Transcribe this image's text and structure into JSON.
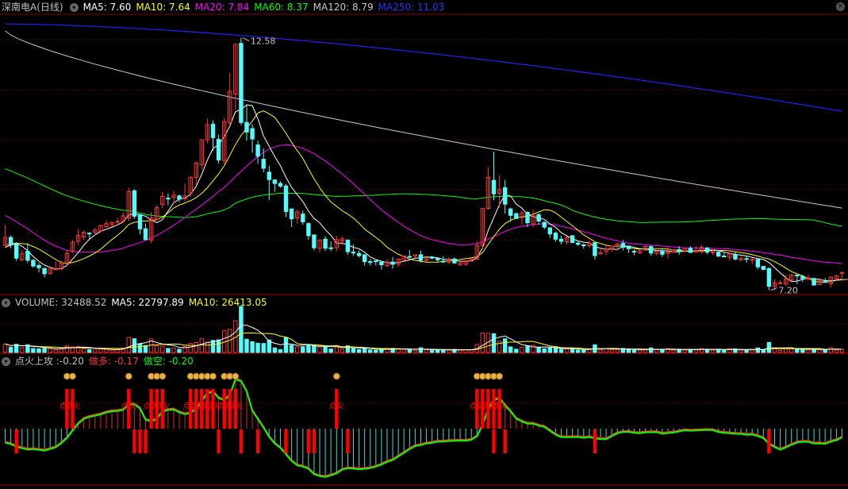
{
  "colors": {
    "up": "#ff3232",
    "down": "#54fcfc",
    "ma5": "#ffffff",
    "ma10": "#ffff00",
    "ma20": "#ff00ff",
    "ma60": "#00ff00",
    "ma120": "#c8c8c8",
    "ma250": "#2020ff",
    "grid": "#8b0000",
    "signal": "#ff0000",
    "spark": "#ffff00"
  },
  "price_panel": {
    "title": "深南电A(日线)",
    "ma5": "MA5: 7.60",
    "ma10": "MA10: 7.64",
    "ma20": "MA20: 7.84",
    "ma60": "MA60: 8.37",
    "ma120": "MA120: 8.79",
    "ma250": "MA250: 11.03",
    "high_label": "12.58",
    "low_label": "7.20"
  },
  "volume_panel": {
    "title": "VOLUME: 32488.52",
    "ma5": "MA5: 22797.89",
    "ma10": "MA10: 26413.05"
  },
  "indicator_panel": {
    "title": "点火上攻 :-0.20",
    "zuoduo": "做多: -0.17",
    "zuokong": "做空: -0.20",
    "fire_label": "点火"
  },
  "chart_data": {
    "type": "candlestick",
    "ylim": [
      6.9,
      13.2
    ],
    "candles": [
      [
        7.93,
        8.11,
        8.4,
        7.87
      ],
      [
        8.11,
        7.94,
        8.16,
        7.86
      ],
      [
        7.95,
        7.63,
        8.0,
        7.57
      ],
      [
        7.59,
        7.73,
        7.82,
        7.56
      ],
      [
        7.79,
        7.58,
        7.98,
        7.52
      ],
      [
        7.58,
        7.45,
        7.62,
        7.41
      ],
      [
        7.46,
        7.41,
        7.52,
        7.3
      ],
      [
        7.39,
        7.27,
        7.42,
        7.19
      ],
      [
        7.28,
        7.39,
        7.44,
        7.24
      ],
      [
        7.37,
        7.38,
        7.56,
        7.36
      ],
      [
        7.38,
        7.52,
        7.58,
        7.35
      ],
      [
        7.5,
        7.74,
        7.82,
        7.46
      ],
      [
        7.79,
        8.0,
        8.05,
        7.75
      ],
      [
        8.02,
        8.16,
        8.3,
        7.93
      ],
      [
        8.12,
        8.23,
        8.27,
        8.05
      ],
      [
        8.21,
        8.2,
        8.23,
        8.05
      ],
      [
        8.23,
        8.28,
        8.33,
        8.16
      ],
      [
        8.26,
        8.38,
        8.41,
        8.23
      ],
      [
        8.36,
        8.43,
        8.5,
        8.33
      ],
      [
        8.41,
        8.45,
        8.49,
        8.36
      ],
      [
        8.47,
        8.48,
        8.57,
        8.4
      ],
      [
        8.49,
        8.61,
        8.69,
        8.44
      ],
      [
        8.56,
        9.17,
        9.26,
        8.49
      ],
      [
        9.19,
        8.6,
        9.23,
        8.54
      ],
      [
        8.64,
        8.31,
        8.65,
        8.18
      ],
      [
        8.31,
        8.06,
        8.43,
        8.05
      ],
      [
        8.05,
        8.56,
        8.7,
        7.98
      ],
      [
        8.53,
        8.8,
        8.86,
        8.5
      ],
      [
        8.87,
        9.06,
        9.16,
        8.79
      ],
      [
        9.02,
        9.0,
        9.13,
        8.86
      ],
      [
        9.04,
        9.09,
        9.19,
        8.9
      ],
      [
        9.07,
        9.0,
        9.1,
        8.93
      ],
      [
        9.01,
        9.07,
        9.36,
        8.95
      ],
      [
        9.14,
        9.5,
        9.53,
        9.05
      ],
      [
        9.5,
        9.83,
        9.87,
        9.31
      ],
      [
        9.79,
        10.37,
        10.37,
        9.68
      ],
      [
        10.37,
        10.72,
        10.86,
        10.29
      ],
      [
        10.73,
        10.42,
        10.82,
        10.11
      ],
      [
        10.38,
        9.9,
        10.49,
        9.82
      ],
      [
        9.89,
        10.79,
        10.88,
        9.81
      ],
      [
        10.77,
        11.49,
        11.91,
        10.7
      ],
      [
        11.43,
        12.58,
        12.58,
        11.06
      ],
      [
        12.6,
        10.77,
        12.73,
        10.71
      ],
      [
        10.77,
        10.55,
        11.18,
        10.35
      ],
      [
        10.63,
        10.39,
        10.73,
        10.07
      ],
      [
        10.25,
        9.99,
        10.35,
        9.81
      ],
      [
        9.92,
        9.71,
        10.17,
        9.62
      ],
      [
        9.62,
        9.45,
        9.77,
        8.97
      ],
      [
        9.44,
        9.36,
        9.46,
        9.17
      ],
      [
        9.36,
        9.3,
        9.41,
        9.26
      ],
      [
        9.3,
        8.71,
        9.35,
        8.58
      ],
      [
        8.77,
        8.54,
        8.77,
        8.35
      ],
      [
        8.56,
        8.7,
        8.76,
        8.43
      ],
      [
        8.65,
        8.47,
        8.73,
        8.4
      ],
      [
        8.43,
        8.15,
        8.46,
        8.06
      ],
      [
        8.17,
        7.87,
        8.17,
        7.81
      ],
      [
        7.86,
        8.05,
        8.07,
        7.76
      ],
      [
        8.07,
        7.86,
        8.14,
        7.8
      ],
      [
        7.87,
        7.86,
        8.02,
        7.79
      ],
      [
        7.87,
        8.06,
        8.15,
        7.79
      ],
      [
        8.03,
        8.08,
        8.13,
        7.92
      ],
      [
        8.05,
        7.78,
        8.06,
        7.71
      ],
      [
        7.77,
        7.75,
        7.95,
        7.69
      ],
      [
        7.74,
        7.69,
        7.81,
        7.65
      ],
      [
        7.71,
        7.55,
        7.72,
        7.46
      ],
      [
        7.55,
        7.53,
        7.61,
        7.46
      ],
      [
        7.57,
        7.55,
        7.57,
        7.46
      ],
      [
        7.54,
        7.48,
        7.57,
        7.37
      ],
      [
        7.46,
        7.54,
        7.61,
        7.42
      ],
      [
        7.54,
        7.49,
        7.66,
        7.39
      ],
      [
        7.49,
        7.61,
        7.62,
        7.42
      ],
      [
        7.59,
        7.68,
        7.68,
        7.53
      ],
      [
        7.67,
        7.66,
        7.82,
        7.64
      ],
      [
        7.68,
        7.71,
        7.72,
        7.63
      ],
      [
        7.71,
        7.58,
        7.8,
        7.53
      ],
      [
        7.58,
        7.64,
        7.68,
        7.54
      ],
      [
        7.66,
        7.63,
        7.67,
        7.6
      ],
      [
        7.62,
        7.59,
        7.65,
        7.55
      ],
      [
        7.56,
        7.55,
        7.68,
        7.52
      ],
      [
        7.53,
        7.61,
        7.65,
        7.51
      ],
      [
        7.61,
        7.52,
        7.65,
        7.5
      ],
      [
        7.48,
        7.52,
        7.56,
        7.45
      ],
      [
        7.49,
        7.57,
        7.58,
        7.45
      ],
      [
        7.56,
        7.61,
        7.65,
        7.54
      ],
      [
        7.61,
        7.92,
        8.03,
        7.6
      ],
      [
        7.92,
        8.78,
        8.79,
        7.85
      ],
      [
        8.78,
        9.5,
        9.74,
        8.76
      ],
      [
        9.43,
        9.12,
        10.09,
        8.97
      ],
      [
        9.13,
        9.22,
        9.55,
        8.79
      ],
      [
        9.26,
        8.88,
        9.44,
        8.66
      ],
      [
        8.77,
        8.62,
        8.8,
        8.47
      ],
      [
        8.66,
        8.55,
        8.69,
        8.54
      ],
      [
        8.57,
        8.68,
        8.73,
        8.4
      ],
      [
        8.69,
        8.45,
        8.71,
        8.35
      ],
      [
        8.42,
        8.63,
        8.76,
        8.35
      ],
      [
        8.64,
        8.49,
        8.67,
        8.4
      ],
      [
        8.46,
        8.35,
        8.49,
        8.3
      ],
      [
        8.33,
        8.19,
        8.35,
        8.1
      ],
      [
        8.21,
        8.07,
        8.25,
        8.01
      ],
      [
        8.07,
        8.02,
        8.15,
        7.95
      ],
      [
        8.01,
        8.11,
        8.14,
        7.95
      ],
      [
        8.15,
        7.99,
        8.15,
        7.98
      ],
      [
        7.98,
        7.95,
        8.04,
        7.92
      ],
      [
        7.94,
        7.92,
        7.97,
        7.85
      ],
      [
        7.92,
        7.98,
        8.04,
        7.86
      ],
      [
        7.99,
        7.69,
        8.01,
        7.6
      ],
      [
        7.73,
        7.76,
        7.88,
        7.71
      ],
      [
        7.79,
        7.84,
        7.95,
        7.7
      ],
      [
        7.85,
        7.91,
        7.91,
        7.78
      ],
      [
        7.92,
        7.96,
        7.99,
        7.82
      ],
      [
        7.97,
        7.88,
        8.05,
        7.81
      ],
      [
        7.91,
        7.85,
        7.93,
        7.75
      ],
      [
        7.79,
        7.78,
        7.82,
        7.7
      ],
      [
        7.75,
        7.8,
        7.83,
        7.73
      ],
      [
        7.82,
        7.9,
        7.92,
        7.8
      ],
      [
        7.9,
        7.75,
        7.93,
        7.69
      ],
      [
        7.74,
        7.79,
        7.86,
        7.7
      ],
      [
        7.79,
        7.72,
        7.84,
        7.66
      ],
      [
        7.74,
        7.77,
        7.88,
        7.62
      ],
      [
        7.77,
        7.83,
        7.84,
        7.76
      ],
      [
        7.83,
        7.79,
        7.91,
        7.71
      ],
      [
        7.8,
        7.86,
        7.86,
        7.76
      ],
      [
        7.86,
        7.76,
        7.91,
        7.76
      ],
      [
        7.77,
        7.81,
        7.91,
        7.76
      ],
      [
        7.78,
        7.88,
        7.94,
        7.73
      ],
      [
        7.87,
        7.77,
        7.88,
        7.72
      ],
      [
        7.76,
        7.78,
        7.83,
        7.7
      ],
      [
        7.77,
        7.68,
        7.82,
        7.65
      ],
      [
        7.68,
        7.67,
        7.75,
        7.65
      ],
      [
        7.65,
        7.73,
        7.78,
        7.57
      ],
      [
        7.71,
        7.61,
        7.77,
        7.58
      ],
      [
        7.59,
        7.63,
        7.67,
        7.56
      ],
      [
        7.62,
        7.61,
        7.67,
        7.52
      ],
      [
        7.6,
        7.6,
        7.64,
        7.49
      ],
      [
        7.6,
        7.43,
        7.6,
        7.37
      ],
      [
        7.44,
        7.37,
        7.44,
        7.35
      ],
      [
        7.39,
        6.98,
        7.42,
        6.89
      ],
      [
        6.98,
        7.06,
        7.14,
        6.89
      ],
      [
        7.06,
        7.06,
        7.12,
        7.02
      ],
      [
        7.03,
        7.15,
        7.24,
        6.98
      ],
      [
        7.12,
        7.24,
        7.27,
        7.09
      ],
      [
        7.24,
        7.22,
        7.24,
        7.03
      ],
      [
        7.21,
        7.16,
        7.24,
        7.08
      ],
      [
        7.14,
        7.17,
        7.25,
        7.13
      ],
      [
        7.16,
        7.01,
        7.17,
        6.99
      ],
      [
        7.02,
        7.12,
        7.16,
        7.02
      ],
      [
        7.09,
        7.07,
        7.17,
        7.06
      ],
      [
        7.04,
        7.19,
        7.21,
        6.95
      ],
      [
        7.15,
        7.23,
        7.24,
        7.12
      ],
      [
        7.28,
        7.3,
        7.32,
        7.11
      ]
    ],
    "ma5": [
      7.88,
      7.93,
      7.97,
      7.91,
      7.8,
      7.67,
      7.56,
      7.47,
      7.42,
      7.38,
      7.39,
      7.46,
      7.61,
      7.76,
      7.93,
      8.07,
      8.17,
      8.25,
      8.3,
      8.35,
      8.4,
      8.47,
      8.63,
      8.66,
      8.64,
      8.6,
      8.52,
      8.45,
      8.52,
      8.72,
      8.91,
      9.0,
      9.02,
      9.11,
      9.29,
      9.57,
      9.9,
      10.17,
      10.25,
      10.44,
      10.68,
      11.02,
      11.07,
      11.18,
      11.16,
      10.86,
      10.46,
      10.22,
      9.98,
      9.77,
      9.5,
      9.27,
      9.1,
      8.94,
      8.72,
      8.55,
      8.45,
      8.29,
      8.16,
      7.98,
      7.98,
      7.94,
      7.88,
      7.85,
      7.77,
      7.66,
      7.6,
      7.56,
      7.53,
      7.52,
      7.53,
      7.56,
      7.59,
      7.63,
      7.64,
      7.66,
      7.65,
      7.64,
      7.6,
      7.61,
      7.58,
      7.56,
      7.56,
      7.57,
      7.64,
      7.87,
      8.27,
      8.57,
      8.87,
      9.1,
      9.07,
      8.88,
      8.79,
      8.64,
      8.59,
      8.56,
      8.53,
      8.42,
      8.35,
      8.22,
      8.15,
      8.08,
      8.03,
      8.0,
      7.99,
      7.9,
      7.86,
      7.84,
      7.84,
      7.83,
      7.91,
      7.91,
      7.88,
      7.85,
      7.84,
      7.82,
      7.81,
      7.8,
      7.8,
      7.77,
      7.78,
      7.79,
      7.8,
      7.81,
      7.81,
      7.82,
      7.82,
      7.81,
      7.77,
      7.74,
      7.72,
      7.7,
      7.68,
      7.65,
      7.62,
      7.6,
      7.53,
      7.41,
      7.29,
      7.18,
      7.09,
      7.1,
      7.14,
      7.17,
      7.15,
      7.14,
      7.11,
      7.11,
      7.12,
      7.14
    ],
    "ma10": [
      7.92,
      7.96,
      7.98,
      7.97,
      7.95,
      7.9,
      7.84,
      7.76,
      7.68,
      7.6,
      7.53,
      7.51,
      7.53,
      7.57,
      7.62,
      7.68,
      7.75,
      7.84,
      7.95,
      8.06,
      8.16,
      8.27,
      8.41,
      8.46,
      8.48,
      8.49,
      8.5,
      8.52,
      8.58,
      8.68,
      8.79,
      8.86,
      8.91,
      8.96,
      9.03,
      9.13,
      9.26,
      9.42,
      9.58,
      9.77,
      10.01,
      10.26,
      10.47,
      10.64,
      10.8,
      10.99,
      11.04,
      10.97,
      10.89,
      10.71,
      10.52,
      10.31,
      10.12,
      9.94,
      9.7,
      9.47,
      9.26,
      9.08,
      8.93,
      8.83,
      8.73,
      8.65,
      8.56,
      8.44,
      8.3,
      8.21,
      8.11,
      8.01,
      7.88,
      7.8,
      7.72,
      7.67,
      7.61,
      7.58,
      7.56,
      7.54,
      7.54,
      7.54,
      7.56,
      7.57,
      7.59,
      7.6,
      7.62,
      7.64,
      7.66,
      7.76,
      7.95,
      8.13,
      8.3,
      8.43,
      8.51,
      8.56,
      8.59,
      8.61,
      8.65,
      8.7,
      8.75,
      8.74,
      8.68,
      8.58,
      8.48,
      8.38,
      8.28,
      8.17,
      8.09,
      8.01,
      7.97,
      7.93,
      7.91,
      7.91,
      7.91,
      7.88,
      7.85,
      7.84,
      7.85,
      7.84,
      7.85,
      7.85,
      7.84,
      7.82,
      7.81,
      7.8,
      7.79,
      7.8,
      7.8,
      7.8,
      7.81,
      7.81,
      7.81,
      7.8,
      7.78,
      7.76,
      7.74,
      7.71,
      7.68,
      7.64,
      7.61,
      7.55,
      7.48,
      7.4,
      7.32,
      7.27,
      7.22,
      7.16,
      7.1,
      7.08,
      7.08,
      7.09,
      7.12,
      7.13,
      7.14
    ],
    "ma20": [
      8.62,
      8.55,
      8.47,
      8.39,
      8.31,
      8.22,
      8.13,
      8.05,
      7.97,
      7.91,
      7.86,
      7.81,
      7.79,
      7.77,
      7.77,
      7.77,
      7.77,
      7.77,
      7.79,
      7.81,
      7.83,
      7.86,
      7.91,
      7.95,
      7.99,
      8.04,
      8.1,
      8.16,
      8.23,
      8.31,
      8.39,
      8.48,
      8.57,
      8.67,
      8.76,
      8.86,
      8.96,
      9.06,
      9.17,
      9.27,
      9.39,
      9.52,
      9.64,
      9.76,
      9.88,
      9.98,
      10.08,
      10.15,
      10.21,
      10.24,
      10.26,
      10.24,
      10.21,
      10.17,
      10.11,
      10.05,
      9.96,
      9.88,
      9.78,
      9.68,
      9.58,
      9.47,
      9.35,
      9.23,
      9.11,
      8.99,
      8.86,
      8.75,
      8.65,
      8.55,
      8.46,
      8.37,
      8.29,
      8.22,
      8.15,
      8.1,
      8.06,
      8.03,
      8.0,
      7.97,
      7.95,
      7.94,
      7.94,
      7.95,
      7.97,
      8.01,
      8.07,
      8.13,
      8.19,
      8.25,
      8.3,
      8.34,
      8.37,
      8.39,
      8.41,
      8.42,
      8.43,
      8.42,
      8.4,
      8.37,
      8.34,
      8.31,
      8.28,
      8.24,
      8.21,
      8.17,
      8.13,
      8.09,
      8.06,
      8.03,
      8.0,
      7.98,
      7.96,
      7.95,
      7.94,
      7.93,
      7.92,
      7.91,
      7.9,
      7.89,
      7.88,
      7.87,
      7.87,
      7.87,
      7.86,
      7.86,
      7.86,
      7.85,
      7.85,
      7.84,
      7.83,
      7.82,
      7.81,
      7.79,
      7.78,
      7.76,
      7.74,
      7.72,
      7.7,
      7.68,
      7.65,
      7.63,
      7.61,
      7.59,
      7.57,
      7.55,
      7.54,
      7.53,
      7.52,
      7.5
    ]
  }
}
